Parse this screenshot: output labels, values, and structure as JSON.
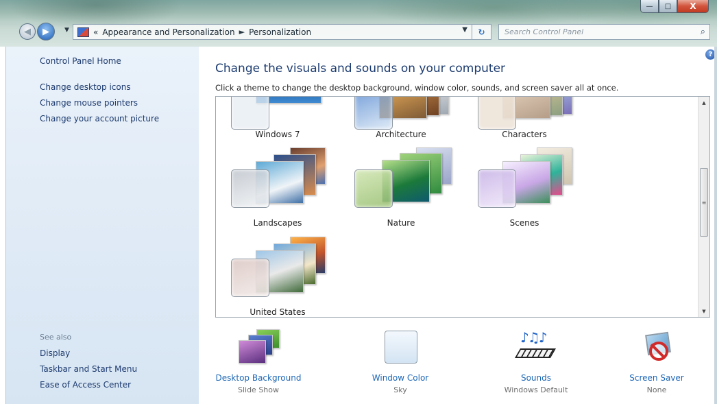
{
  "window": {
    "caption_buttons": {
      "minimize": "—",
      "maximize": "□",
      "close": "X"
    }
  },
  "nav": {
    "back_glyph": "◀",
    "forward_glyph": "▶",
    "history_glyph": "▼",
    "breadcrumb_overflow": "«",
    "breadcrumb": [
      "Appearance and Personalization",
      "Personalization"
    ],
    "breadcrumb_separator": "►",
    "address_dropdown_glyph": "▼",
    "refresh_glyph": "↻",
    "search_placeholder": "Search Control Panel",
    "search_icon": "⌕"
  },
  "sidebar": {
    "home": "Control Panel Home",
    "tasks": [
      "Change desktop icons",
      "Change mouse pointers",
      "Change your account picture"
    ],
    "see_also_label": "See also",
    "see_also": [
      "Display",
      "Taskbar and Start Menu",
      "Ease of Access Center"
    ]
  },
  "main": {
    "help_icon": "?",
    "title": "Change the visuals and sounds on your computer",
    "subtitle": "Click a theme to change the desktop background, window color, sounds, and screen saver all at once.",
    "themes": [
      {
        "name": "Windows 7"
      },
      {
        "name": "Architecture"
      },
      {
        "name": "Characters"
      },
      {
        "name": "Landscapes"
      },
      {
        "name": "Nature"
      },
      {
        "name": "Scenes"
      },
      {
        "name": "United States"
      }
    ],
    "scrollbar": {
      "up": "▲",
      "down": "▼",
      "grip": "≡"
    }
  },
  "settings": [
    {
      "label": "Desktop Background",
      "value": "Slide Show"
    },
    {
      "label": "Window Color",
      "value": "Sky"
    },
    {
      "label": "Sounds",
      "value": "Windows Default",
      "glyph": "♪♫♪"
    },
    {
      "label": "Screen Saver",
      "value": "None"
    }
  ],
  "colors": {
    "link": "#1c3a6e",
    "setting_link": "#1c66b6",
    "title": "#1b3b6f",
    "left_pane_bg": "#dfeaf6"
  }
}
